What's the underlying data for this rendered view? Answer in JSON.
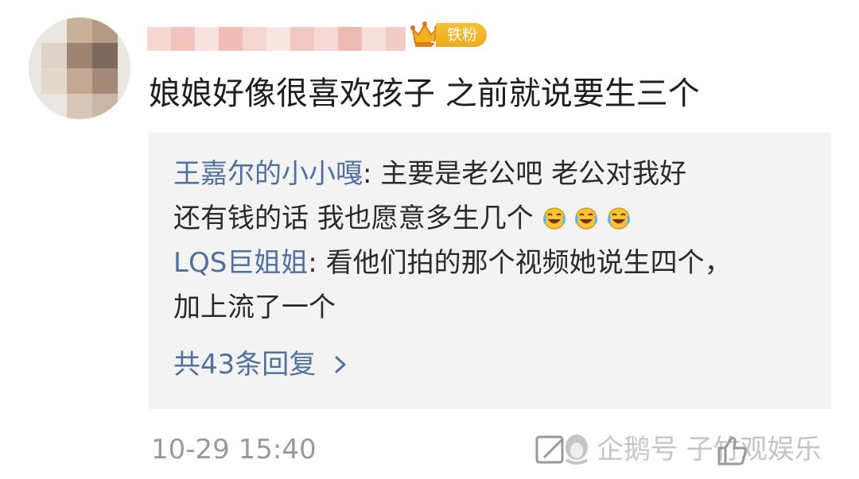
{
  "comment": {
    "text": "娘娘好像很喜欢孩子 之前就说要生三个",
    "badge_label": "铁粉",
    "badge_level": "2",
    "timestamp": "10-29 15:40"
  },
  "replies": [
    {
      "author": "王嘉尔的小小嘎",
      "separator": ":",
      "text_line1": " 主要是老公吧  老公对我好",
      "text_line2": "还有钱的话  我也愿意多生几个  ",
      "emoji_icon": "laugh-cry-emoji"
    },
    {
      "author": "LQS巨姐姐",
      "separator": ":",
      "text_line1": " 看他们拍的那个视频她说生四个，",
      "text_line2": "加上流了一个"
    }
  ],
  "more_replies_label": "共43条回复",
  "watermark": {
    "text": "企鹅号 子竹观娱乐"
  },
  "colors": {
    "link": "#50709f",
    "reply_bg": "#f3f3f3",
    "badge": "#f1b226",
    "muted": "#9a9a9a"
  }
}
